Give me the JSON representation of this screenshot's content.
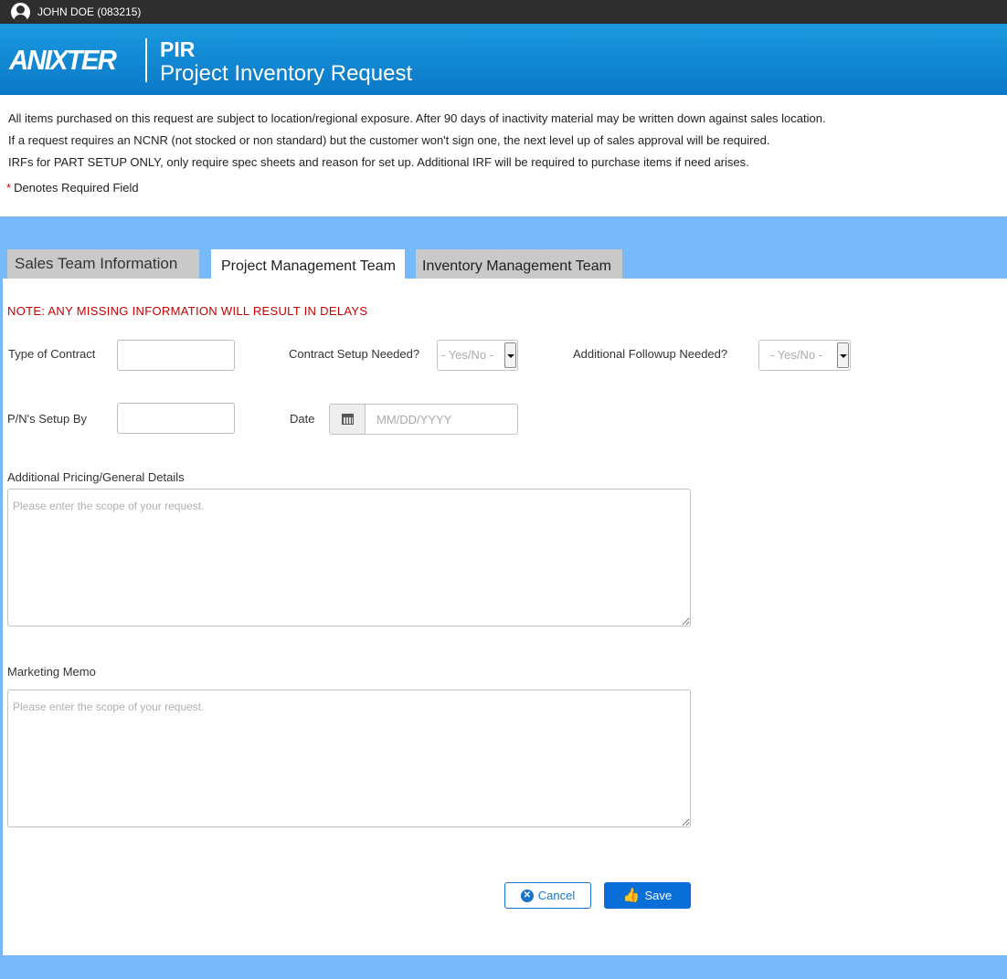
{
  "user": {
    "name": "JOHN DOE (083215)",
    "avatar_icon": "user-circle-icon"
  },
  "header": {
    "logo_text": "ANIXTER",
    "app_code": "PIR",
    "app_title": "Project Inventory Request"
  },
  "notes": [
    "All items purchased on this request are subject to location/regional exposure.  After 90 days of inactivity material may be written down against sales location.",
    "If a request requires an NCNR (not stocked or non standard) but the customer won't sign one, the next level up of sales approval will be required.",
    "IRFs for PART SETUP ONLY, only require spec sheets and reason for set up.  Additional IRF will be required to purchase items if need arises."
  ],
  "required_note": {
    "star": "*",
    "text": "Denotes Required Field"
  },
  "tabs": [
    {
      "label": "Sales Team Information",
      "active": false
    },
    {
      "label": "Project Management Team",
      "active": true
    },
    {
      "label": "Inventory Management Team",
      "active": false
    }
  ],
  "form": {
    "warning": "NOTE: ANY MISSING INFORMATION WILL RESULT IN DELAYS",
    "type_of_contract": {
      "label": "Type of Contract",
      "value": ""
    },
    "contract_setup": {
      "label": "Contract Setup Needed?",
      "selected": "- Yes/No -"
    },
    "additional_followup": {
      "label": "Additional Followup Needed?",
      "selected": "- Yes/No -"
    },
    "pn_setup_by": {
      "label": "P/N's Setup By",
      "value": ""
    },
    "date": {
      "label": "Date",
      "placeholder": "MM/DD/YYYY",
      "icon": "calendar-icon"
    },
    "pricing_details": {
      "label": "Additional Pricing/General Details",
      "placeholder": "Please enter the scope of your request."
    },
    "marketing_memo": {
      "label": "Marketing Memo",
      "placeholder": "Please enter the scope of your request."
    }
  },
  "actions": {
    "cancel": {
      "label": "Cancel",
      "icon": "times-circle-icon"
    },
    "save": {
      "label": "Save",
      "icon": "thumbs-up-icon"
    }
  },
  "colors": {
    "header_blue": "#0b78c6",
    "panel_blue": "#78b9fb",
    "save_blue": "#0a6ed8",
    "warning_red": "#c40000"
  }
}
